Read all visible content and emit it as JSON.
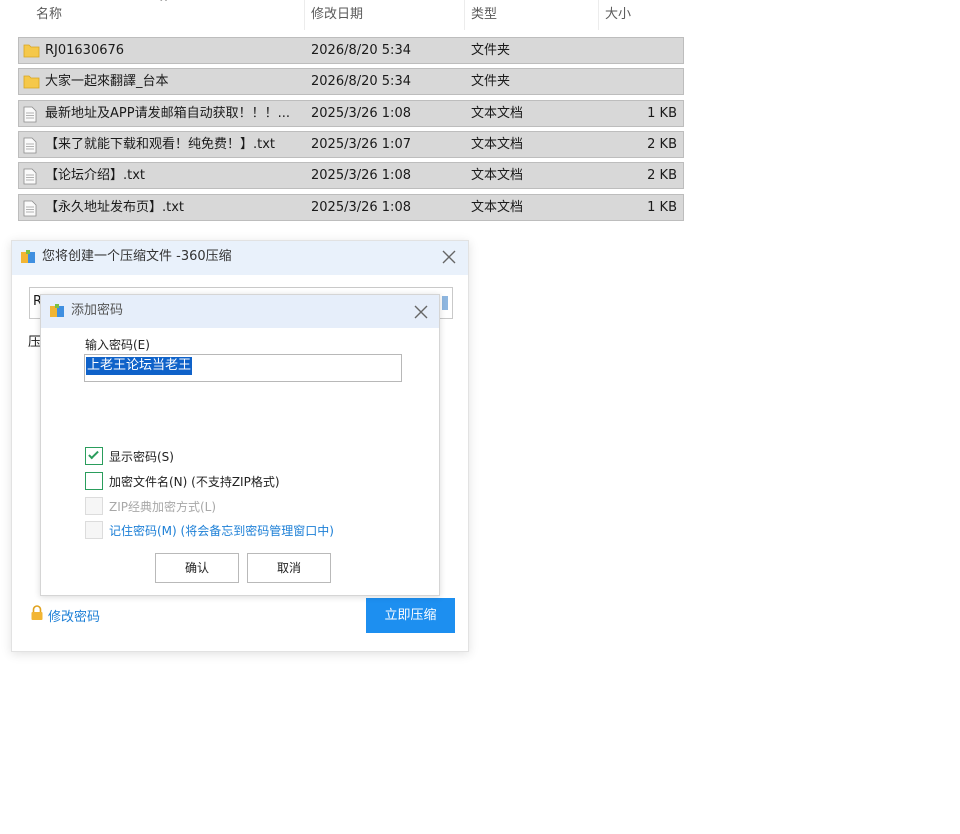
{
  "explorer": {
    "columns": {
      "name": "名称",
      "date": "修改日期",
      "type": "类型",
      "size": "大小"
    },
    "files": [
      {
        "name": "RJ01630676",
        "date": "2026/8/20 5:34",
        "type": "文件夹",
        "size": "",
        "icon": "folder-icon"
      },
      {
        "name": "大家一起來翻譯_台本",
        "date": "2026/8/20 5:34",
        "type": "文件夹",
        "size": "",
        "icon": "folder-icon"
      },
      {
        "name": "最新地址及APP请发邮箱自动获取！！！...",
        "date": "2025/3/26 1:08",
        "type": "文本文档",
        "size": "1 KB",
        "icon": "text-file-icon"
      },
      {
        "name": "【来了就能下载和观看！纯免费！】.txt",
        "date": "2025/3/26 1:07",
        "type": "文本文档",
        "size": "2 KB",
        "icon": "text-file-icon"
      },
      {
        "name": "【论坛介绍】.txt",
        "date": "2025/3/26 1:08",
        "type": "文本文档",
        "size": "2 KB",
        "icon": "text-file-icon"
      },
      {
        "name": "【永久地址发布页】.txt",
        "date": "2025/3/26 1:08",
        "type": "文本文档",
        "size": "1 KB",
        "icon": "text-file-icon"
      }
    ]
  },
  "compress_dialog": {
    "title": "您将创建一个压缩文件 -360压缩",
    "field_partial": "R",
    "side_label_partial": "压",
    "change_password": "修改密码",
    "compress_button": "立即压缩"
  },
  "password_dialog": {
    "title": "添加密码",
    "input_label": "输入密码(E)",
    "password_value": "上老王论坛当老王",
    "options": [
      {
        "label": "显示密码(S)",
        "checked": true,
        "disabled": false,
        "style": "normal"
      },
      {
        "label": "加密文件名(N) (不支持ZIP格式)",
        "checked": false,
        "disabled": false,
        "style": "normal"
      },
      {
        "label": "ZIP经典加密方式(L)",
        "checked": false,
        "disabled": true,
        "style": "disabled"
      },
      {
        "label": "记住密码(M) (将会备忘到密码管理窗口中)",
        "checked": false,
        "disabled": false,
        "style": "link"
      }
    ],
    "ok_button": "确认",
    "cancel_button": "取消"
  },
  "colors": {
    "selection_row": "#d8d8d8",
    "accent_blue": "#1d8ff0",
    "link_blue": "#1c7fd6",
    "checkbox_green": "#2a9d5c",
    "folder_yellow": "#f5c84a"
  }
}
